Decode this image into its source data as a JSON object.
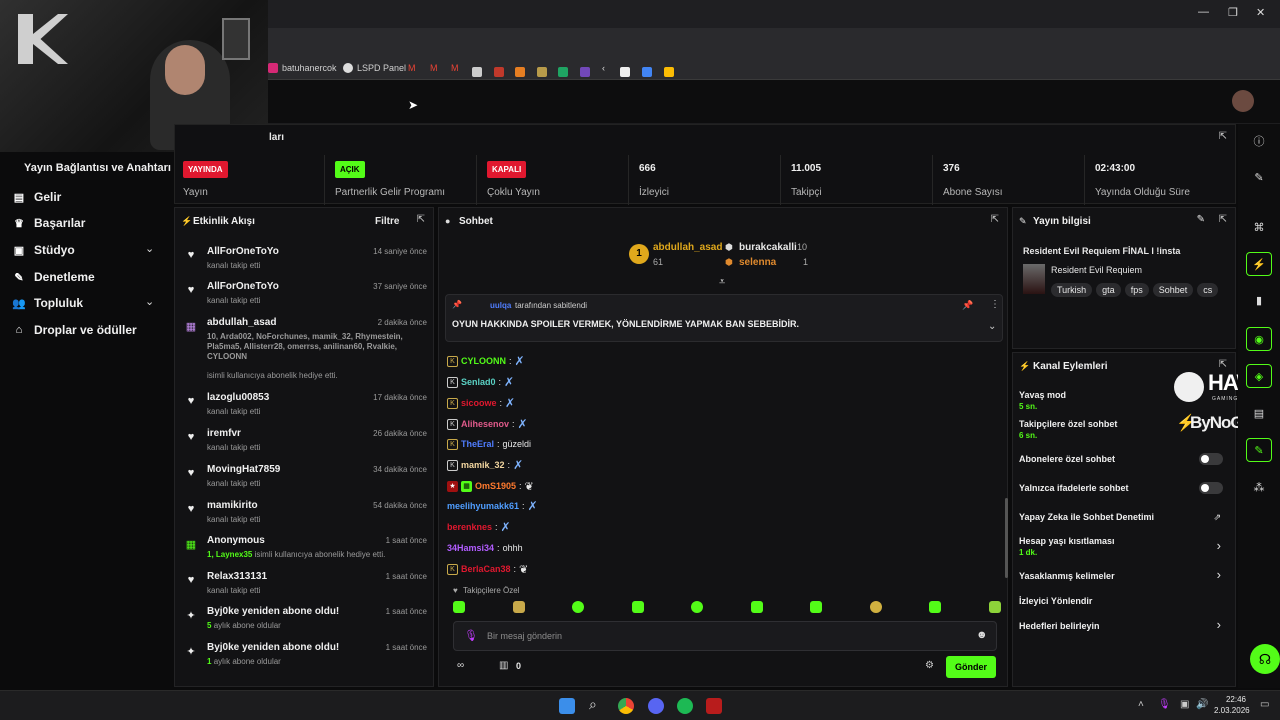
{
  "browser": {
    "bookmarks": [
      {
        "label": "batuhanercok"
      },
      {
        "label": "LSPD Panel"
      }
    ]
  },
  "sidebar": {
    "header": "Yayın Bağlantısı ve Anahtarı",
    "items": [
      {
        "label": "Gelir",
        "icon": "chart-icon"
      },
      {
        "label": "Başarılar",
        "icon": "trophy-icon"
      },
      {
        "label": "Stüdyo",
        "icon": "studio-icon",
        "expandable": true
      },
      {
        "label": "Denetleme",
        "icon": "wrench-icon"
      },
      {
        "label": "Topluluk",
        "icon": "people-icon",
        "expandable": true
      },
      {
        "label": "Droplar ve ödüller",
        "icon": "gift-icon"
      }
    ]
  },
  "stats": {
    "header_partial": "ları",
    "items": [
      {
        "pill": "YAYINDA",
        "pill_color": "#e0182f",
        "label": "Yayın"
      },
      {
        "pill": "AÇIK",
        "pill_color": "#53fc18",
        "label": "Partnerlik Gelir Programı"
      },
      {
        "pill": "KAPALI",
        "pill_color": "#e0182f",
        "label": "Çoklu Yayın"
      },
      {
        "value": "666",
        "label": "İzleyici"
      },
      {
        "value": "11.005",
        "label": "Takipçi"
      },
      {
        "value": "376",
        "label": "Abone Sayısı"
      },
      {
        "value": "02:43:00",
        "label": "Yayında Olduğu Süre"
      }
    ]
  },
  "activity": {
    "title": "Etkinlik Akışı",
    "filter": "Filtre",
    "events": [
      {
        "icon": "heart-icon",
        "name": "AllForOneToYo",
        "time": "14 saniye önce",
        "desc": "kanalı takip etti"
      },
      {
        "icon": "heart-icon",
        "name": "AllForOneToYo",
        "time": "37 saniye önce",
        "desc": "kanalı takip etti"
      },
      {
        "icon": "gift-icon",
        "name": "abdullah_asad",
        "time": "2 dakika önce",
        "highlight": "10, Arda002, NoForchunes, mamik_32, Rhymestein, Pla5ma5, Allisterr28, omerrss, anilinan60, Rvalkie, CYLOONN",
        "desc": "isimli kullanıcıya abonelik hediye etti."
      },
      {
        "icon": "heart-icon",
        "name": "lazoglu00853",
        "time": "17 dakika önce",
        "desc": "kanalı takip etti"
      },
      {
        "icon": "heart-icon",
        "name": "iremfvr",
        "time": "26 dakika önce",
        "desc": "kanalı takip etti"
      },
      {
        "icon": "heart-icon",
        "name": "MovingHat7859",
        "time": "34 dakika önce",
        "desc": "kanalı takip etti"
      },
      {
        "icon": "heart-icon",
        "name": "mamikirito",
        "time": "54 dakika önce",
        "desc": "kanalı takip etti"
      },
      {
        "icon": "gift-icon",
        "name": "Anonymous",
        "time": "1 saat önce",
        "highlight": "1, Laynex35",
        "desc": "isimli kullanıcıya abonelik hediye etti."
      },
      {
        "icon": "heart-icon",
        "name": "Relax313131",
        "time": "1 saat önce",
        "desc": "kanalı takip etti"
      },
      {
        "icon": "sparkle-icon",
        "name": "Byj0ke yeniden abone oldu!",
        "time": "1 saat önce",
        "highlight": "5",
        "desc": "aylık abone oldular"
      },
      {
        "icon": "sparkle-icon",
        "name": "Byj0ke yeniden abone oldu!",
        "time": "1 saat önce",
        "highlight": "1",
        "desc": "aylık abone oldular"
      }
    ]
  },
  "chat": {
    "title": "Sohbet",
    "top_gifters": [
      {
        "rank": "1",
        "name": "abdullah_asad",
        "count": "61"
      },
      {
        "name": "burakcakalli",
        "count": "10"
      },
      {
        "name": "selenna",
        "count": "1"
      }
    ],
    "pinned": {
      "by": "uulqa",
      "by_suffix": "tarafından sabitlendi",
      "text": "OYUN HAKKINDA SPOILER VERMEK, YÖNLENDİRME YAPMAK BAN SEBEBİDİR."
    },
    "messages": [
      {
        "user": "CYLOONN",
        "color": "#53fc18",
        "text": ""
      },
      {
        "user": "Senlad0",
        "color": "#5ad1c4",
        "text": ""
      },
      {
        "user": "sicoowe",
        "color": "#e0182f",
        "text": ""
      },
      {
        "user": "Alihesenov",
        "color": "#e05a8a",
        "text": ""
      },
      {
        "user": "TheEral",
        "color": "#4f7dff",
        "text": "güzeldi"
      },
      {
        "user": "mamik_32",
        "color": "#f2d6a0",
        "text": ""
      },
      {
        "user": "OmS1905",
        "color": "#ff7a2e",
        "text": ""
      },
      {
        "user": "meelihyumakk61",
        "color": "#4f9dff",
        "text": ""
      },
      {
        "user": "berenknes",
        "color": "#e0182f",
        "text": ""
      },
      {
        "user": "34Hamsi34",
        "color": "#b25cff",
        "text": "ohhh"
      },
      {
        "user": "BerlaCan38",
        "color": "#e0182f",
        "text": ""
      }
    ],
    "follower_only": "Takipçilere Özel",
    "input_placeholder": "Bir mesaj gönderin",
    "count": "0",
    "send": "Gönder"
  },
  "stream_info": {
    "title": "Yayın bilgisi",
    "stream_title": "Resident Evil Requiem FİNAL l !insta",
    "game": "Resident Evil Requiem",
    "tags": [
      "Turkish",
      "gta",
      "fps",
      "Sohbet",
      "cs"
    ]
  },
  "channel_actions": {
    "title": "Kanal Eylemleri",
    "rows": [
      {
        "label": "Yavaş mod",
        "sub": "5 sn."
      },
      {
        "label": "Takipçilere özel sohbet",
        "sub": "6 sn."
      },
      {
        "label": "Abonelere özel sohbet",
        "toggle": true
      },
      {
        "label": "Yalnızca ifadelerle sohbet",
        "toggle": true
      },
      {
        "label": "Yapay Zeka ile Sohbet Denetimi"
      },
      {
        "label": "Hesap yaşı kısıtlaması",
        "sub": "1 dk.",
        "arrow": true
      },
      {
        "label": "Yasaklanmış kelimeler",
        "arrow": true
      },
      {
        "label": "İzleyici Yönlendir"
      },
      {
        "label": "Hedefleri belirleyin",
        "arrow": true
      }
    ]
  },
  "overlay": {
    "brand1": "HAWK",
    "brand1_sub": "GAMING CHAIR",
    "brand2": "ByNoGame"
  },
  "taskbar": {
    "time": "22:46",
    "date": "2.03.2026"
  }
}
